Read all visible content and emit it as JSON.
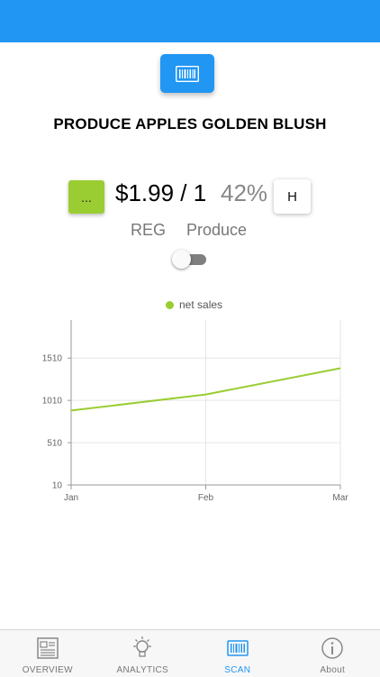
{
  "header": {
    "scan_button_icon": "barcode-icon"
  },
  "product": {
    "title": "PRODUCE APPLES GOLDEN BLUSH",
    "more_label": "...",
    "price": "$1.99 / 1",
    "margin": "42%",
    "h_label": "H",
    "price_type": "REG",
    "department": "Produce",
    "toggle_on": false
  },
  "colors": {
    "accent": "#2196f3",
    "series": "#9acd32",
    "inactive": "#777777"
  },
  "chart_data": {
    "type": "line",
    "categories": [
      "Jan",
      "Feb",
      "Mar"
    ],
    "series": [
      {
        "name": "net sales",
        "values": [
          890,
          1080,
          1390
        ]
      }
    ],
    "yticks": [
      "10",
      "510",
      "1010",
      "1510"
    ],
    "ylim": [
      10,
      1960
    ],
    "grid": true,
    "legend": "top-center"
  },
  "tabs": [
    {
      "label": "OVERVIEW",
      "icon": "newspaper-icon",
      "active": false
    },
    {
      "label": "ANALYTICS",
      "icon": "lightbulb-icon",
      "active": false
    },
    {
      "label": "SCAN",
      "icon": "barcode-icon",
      "active": true
    },
    {
      "label": "About",
      "icon": "info-icon",
      "active": false
    }
  ]
}
